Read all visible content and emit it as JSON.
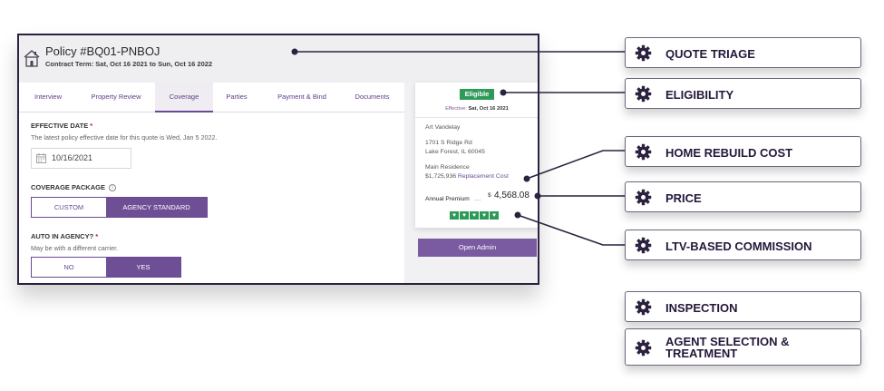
{
  "policy": {
    "title": "Policy #BQ01-PNBOJ",
    "contract_term": "Contract Term: Sat, Oct 16 2021 to Sun, Oct 16 2022"
  },
  "tabs": [
    {
      "label": "Interview",
      "active": false
    },
    {
      "label": "Property Review",
      "active": false
    },
    {
      "label": "Coverage",
      "active": true
    },
    {
      "label": "Parties",
      "active": false
    },
    {
      "label": "Payment & Bind",
      "active": false
    },
    {
      "label": "Documents",
      "active": false
    }
  ],
  "coverage_form": {
    "effective_date_label": "EFFECTIVE DATE",
    "required_mark": "*",
    "effective_date_helper": "The latest policy effective date for this quote is Wed, Jan 5 2022.",
    "effective_date_value": "10/16/2021",
    "coverage_package_label": "COVERAGE PACKAGE",
    "info_glyph": "i",
    "coverage_options": [
      "CUSTOM",
      "AGENCY STANDARD"
    ],
    "coverage_selected": "AGENCY STANDARD",
    "auto_label": "AUTO IN AGENCY?",
    "auto_helper": "May be with a different carrier.",
    "auto_options": [
      "NO",
      "YES"
    ],
    "auto_selected": "YES"
  },
  "summary_card": {
    "status_badge": "Eligible",
    "effective_label": "Effective:",
    "effective_date": "Sat, Oct 16 2021",
    "name": "Art Vandelay",
    "address_line1": "1701 S Ridge Rd",
    "address_line2": "Lake Forest, IL 60045",
    "residence_type": "Main Residence",
    "replacement_cost_value": "$1,725,936",
    "replacement_cost_label": "Replacement Cost",
    "premium_label": "Annual Premium",
    "premium_dots": "....",
    "premium_currency": "$",
    "premium_amount": "4,568.08",
    "heart_count": 5,
    "heart_glyph": "♥",
    "open_admin_label": "Open Admin"
  },
  "callouts": [
    {
      "label": "QUOTE TRIAGE"
    },
    {
      "label": "ELIGIBILITY"
    },
    {
      "label": "HOME REBUILD COST"
    },
    {
      "label": "PRICE"
    },
    {
      "label": "LTV-BASED COMMISSION"
    },
    {
      "label": "INSPECTION"
    },
    {
      "label": "AGENT SELECTION & TREATMENT"
    }
  ],
  "colors": {
    "brand_purple": "#6e4f95",
    "eligible_green": "#2d9a58",
    "callout_text": "#24183a"
  },
  "icons": {
    "header": "house-icon",
    "date_field": "calendar-icon",
    "callout": "gear-icon",
    "loyalty": "heart-icon"
  }
}
